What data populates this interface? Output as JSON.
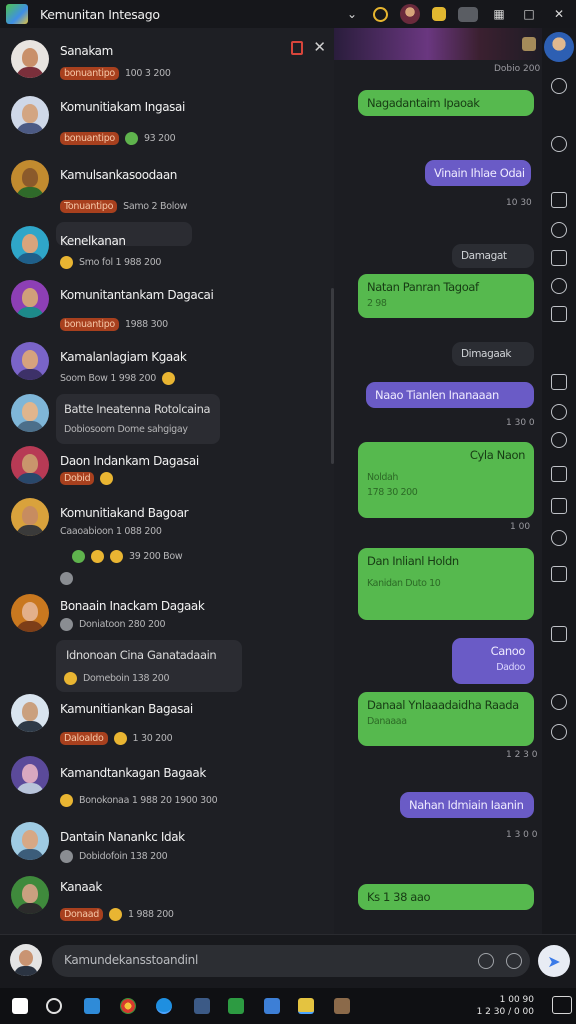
{
  "app": {
    "title": "Kemunitan Intesago"
  },
  "chat_list": {
    "rows": [
      {
        "name": "Sanakam",
        "pill": "bonuantipo",
        "meta": "100 3 200"
      },
      {
        "name": "Komunitiakam Ingasai",
        "pill": "bonuantipo",
        "meta": "93 200"
      },
      {
        "name": "Kamulsankasoodaan",
        "pill": "Tonuantipo",
        "meta": "Samo 2 Bolow"
      },
      {
        "name": "Kenelkanan",
        "pill": "",
        "meta": "Smo fol 1 988 200"
      },
      {
        "name": "Komunitantankam Dagacai",
        "pill": "bonuantipo",
        "meta": "1988 300"
      },
      {
        "name": "Kamalanlagiam Kgaak",
        "pill": "",
        "meta": "Soom Bow 1 998 200"
      },
      {
        "name": "Batte Ineatenna Rotolcaina",
        "pill": "",
        "meta": "Dobiosoom Dome sahgigay"
      },
      {
        "name": "Daon Indankam Dagasai",
        "pill": "Dobid",
        "meta": ""
      },
      {
        "name": "Komunitiakand Bagoar",
        "pill": "",
        "meta": "Caaoabioon 1 088 200"
      },
      {
        "name": "",
        "pill": "",
        "meta": "39 200 Bow"
      },
      {
        "name": "Bonaain Inackam Dagaak",
        "pill": "",
        "meta": "Doniatoon 280 200"
      },
      {
        "name": "Idnonoan Cina Ganatadaain",
        "pill": "",
        "meta": "Domeboin 138 200"
      },
      {
        "name": "Kamunitiankan Bagasai",
        "pill": "Daloaldo",
        "meta": "1 30 200"
      },
      {
        "name": "Kamandtankagan Bagaak",
        "pill": "",
        "meta": "Bonokonaa 1 988 20 1900 300"
      },
      {
        "name": "Dantain Nanankc Idak",
        "pill": "",
        "meta": "Dobidofoin 138 200"
      },
      {
        "name": "Kanaak",
        "pill": "Donaad",
        "meta": "1 988 200"
      }
    ]
  },
  "conversation": {
    "messages": [
      {
        "kind": "ts",
        "text": "Dobio 200"
      },
      {
        "kind": "green",
        "text": "Nagadantaim Ipaoak"
      },
      {
        "kind": "purple",
        "text": "Vinain Ihlae Odai"
      },
      {
        "kind": "ts",
        "text": "10 30"
      },
      {
        "kind": "dark",
        "text": "Damagat"
      },
      {
        "kind": "green",
        "text": "Natan Panran Tagoaf",
        "sub": "2 98"
      },
      {
        "kind": "dark",
        "text": "Dimagaak"
      },
      {
        "kind": "purple",
        "text": "Naao Tianlen Inanaaan"
      },
      {
        "kind": "ts",
        "text": "1 30 0"
      },
      {
        "kind": "green",
        "text": "Cyla Naon",
        "sub": "Noldah",
        "sub2": "178 30 200"
      },
      {
        "kind": "ts",
        "text": "1 00"
      },
      {
        "kind": "green",
        "text": "Dan Inlianl Holdn",
        "sub": "Kanidan Duto 10"
      },
      {
        "kind": "purple",
        "text": "Canoo",
        "sub": "Dadoo"
      },
      {
        "kind": "green",
        "text": "Danaal Ynlaaadaidha Raada",
        "sub": "Danaaaa"
      },
      {
        "kind": "ts",
        "text": "1 2 3 0"
      },
      {
        "kind": "purple",
        "text": "Nahan Idmiain Iaanin"
      },
      {
        "kind": "ts",
        "text": "1 3 0 0"
      },
      {
        "kind": "green",
        "text": "Ks 1 38 aao"
      }
    ]
  },
  "input": {
    "placeholder": "Kamundekansstoandinl"
  },
  "taskbar": {
    "clock_time": "1 00 90",
    "clock_date": "1 2 30 / 0 00"
  },
  "colors": {
    "bubble_green": "#56b94e",
    "bubble_purple": "#6a5bc6",
    "pill_orange": "#a8401e",
    "background": "#1b1c21"
  }
}
